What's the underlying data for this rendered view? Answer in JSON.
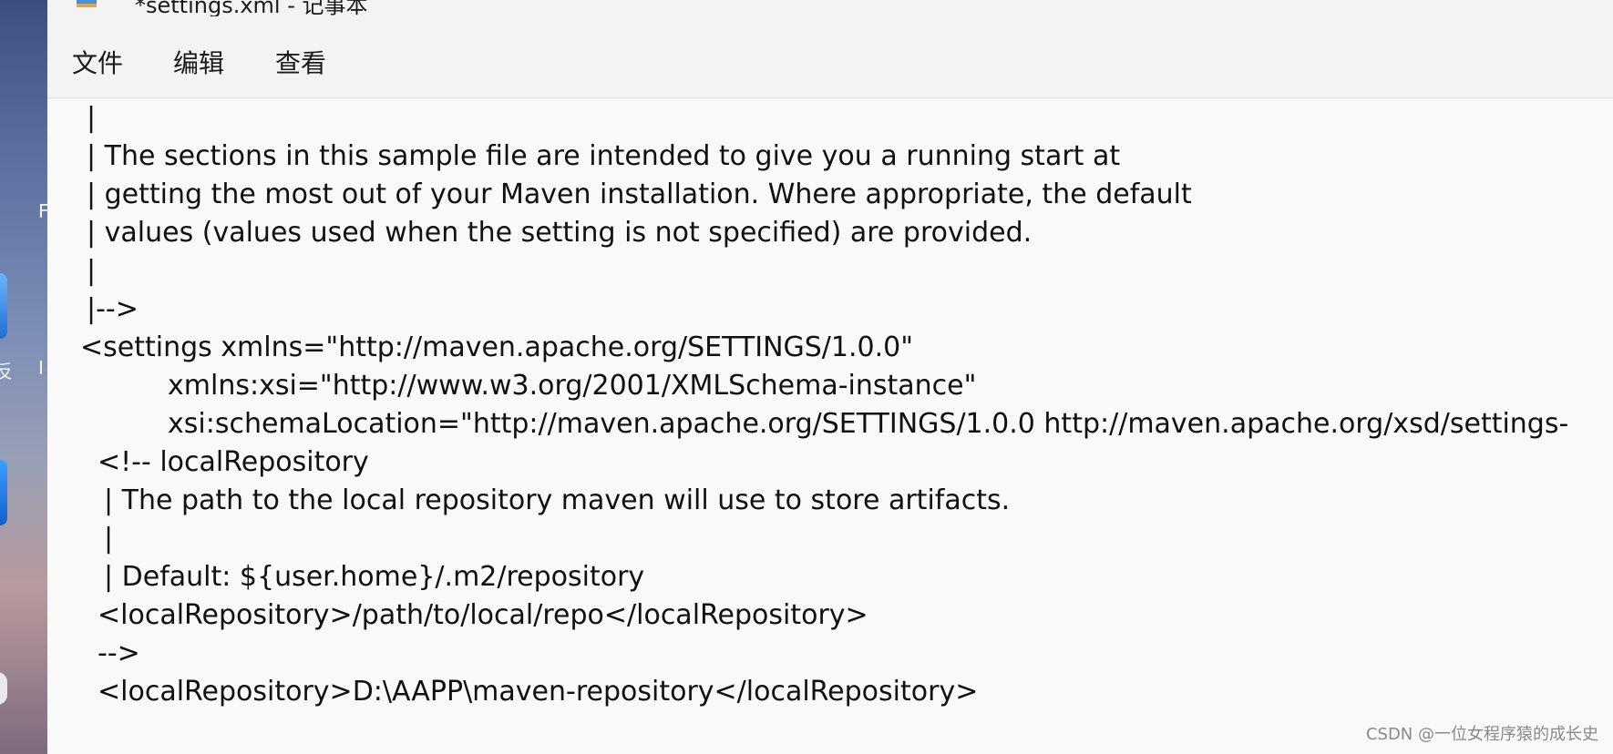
{
  "desktop": {
    "partial_labels": [
      "F",
      "反",
      "I"
    ]
  },
  "window": {
    "title": "*settings.xml - 记事本"
  },
  "menu": {
    "file": "文件",
    "edit": "编辑",
    "view": "查看"
  },
  "editor": {
    "lines": [
      "|",
      "| The sections in this sample file are intended to give you a running start at",
      "| getting the most out of your Maven installation. Where appropriate, the default",
      "| values (values used when the setting is not specified) are provided.",
      "|",
      "|-->",
      "<settings xmlns=\"http://maven.apache.org/SETTINGS/1.0.0\"",
      "xmlns:xsi=\"http://www.w3.org/2001/XMLSchema-instance\"",
      "xsi:schemaLocation=\"http://maven.apache.org/SETTINGS/1.0.0 http://maven.apache.org/xsd/settings-",
      "<!-- localRepository",
      "| The path to the local repository maven will use to store artifacts.",
      "|",
      "| Default: ${user.home}/.m2/repository",
      "<localRepository>/path/to/local/repo</localRepository>",
      "-->",
      "<localRepository>D:\\AAPP\\maven-repository</localRepository>"
    ]
  },
  "watermark": "CSDN @一位女程序猿的成长史"
}
